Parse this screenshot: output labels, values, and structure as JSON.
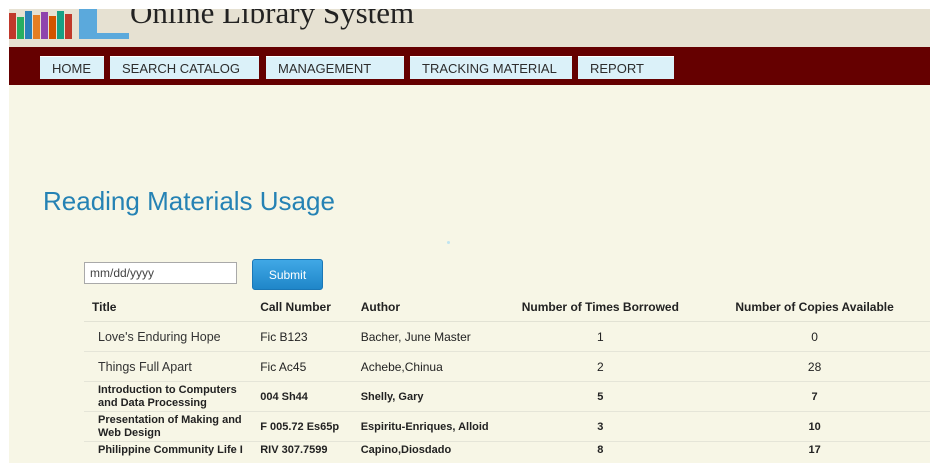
{
  "site": {
    "title": "Online Library System",
    "logo_colors": [
      "#c0392b",
      "#27ae60",
      "#2980b9",
      "#e67e22",
      "#8e44ad",
      "#d35400",
      "#16a085",
      "#c0392b"
    ]
  },
  "nav": {
    "items": [
      {
        "label": "HOME"
      },
      {
        "label": "SEARCH CATALOG"
      },
      {
        "label": "MANAGEMENT"
      },
      {
        "label": "TRACKING MATERIAL"
      },
      {
        "label": "REPORT"
      }
    ]
  },
  "page": {
    "heading": "Reading Materials Usage"
  },
  "form": {
    "date_placeholder": "mm/dd/yyyy",
    "submit_label": "Submit"
  },
  "table": {
    "headers": [
      "Title",
      "Call Number",
      "Author",
      "Number of Times Borrowed",
      "Number of Copies Available"
    ],
    "rows": [
      {
        "title": "Love's Enduring Hope",
        "call_number": "Fic B123",
        "author": "Bacher, June Master",
        "borrowed": "1",
        "available": "0"
      },
      {
        "title": "Things Full Apart",
        "call_number": "Fic Ac45",
        "author": "Achebe,Chinua",
        "borrowed": "2",
        "available": "28"
      },
      {
        "title": "Introduction to Computers and Data Processing",
        "call_number": "004 Sh44",
        "author": "Shelly, Gary",
        "borrowed": "5",
        "available": "7"
      },
      {
        "title": "Presentation of Making and Web Design",
        "call_number": "F 005.72 Es65p",
        "author": "Espiritu-Enriques, Alloid",
        "borrowed": "3",
        "available": "10"
      },
      {
        "title": "Philippine Community Life I",
        "call_number": "RIV 307.7599",
        "author": "Capino,Diosdado",
        "borrowed": "8",
        "available": "17"
      }
    ]
  },
  "colors": {
    "navbar": "#650000",
    "nav_item": "#dbf1f9",
    "heading": "#2582b4",
    "button": "#1f86c9",
    "background": "#f7f6e6"
  }
}
